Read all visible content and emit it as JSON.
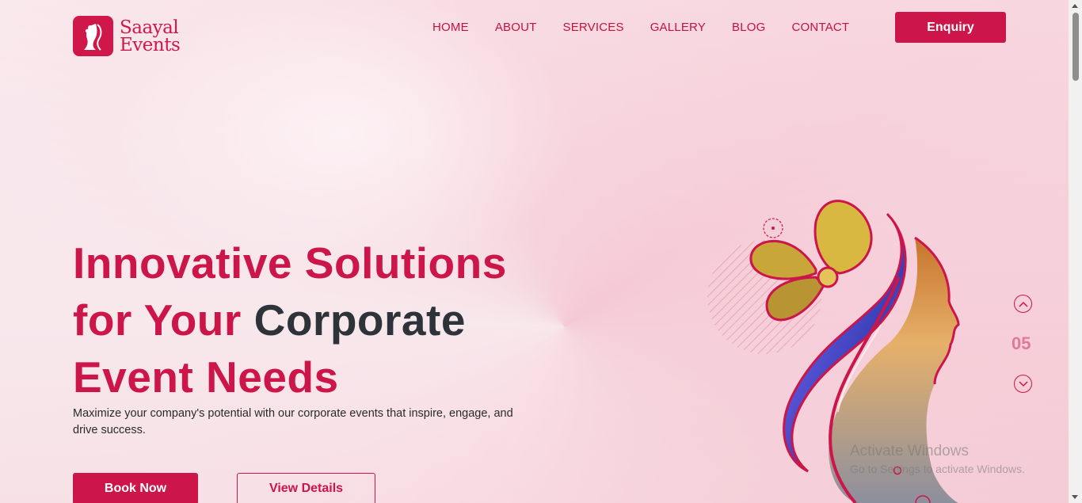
{
  "brand": {
    "line1": "Saayal",
    "line2": "Events",
    "color": "#cc1549"
  },
  "nav": {
    "items": [
      {
        "label": "HOME"
      },
      {
        "label": "ABOUT"
      },
      {
        "label": "SERVICES"
      },
      {
        "label": "GALLERY"
      },
      {
        "label": "BLOG"
      },
      {
        "label": "CONTACT"
      }
    ],
    "enquiry_label": "Enquiry"
  },
  "hero": {
    "title_part1": "Innovative Solutions",
    "title_part2": "for Your ",
    "title_part3": "Corporate",
    "title_part4": "Event Needs",
    "subtitle": "Maximize your company's potential with our corporate events that inspire, engage, and drive success.",
    "book_label": "Book Now",
    "view_label": "View Details"
  },
  "slider": {
    "counter": "05",
    "up_icon": "chevron-up-icon",
    "down_icon": "chevron-down-icon"
  },
  "watermark": {
    "title": "Activate Windows",
    "subtitle": "Go to Settings to activate Windows."
  },
  "colors": {
    "accent": "#cc1549",
    "dark_text": "#2d3338",
    "counter": "#e07a98"
  }
}
